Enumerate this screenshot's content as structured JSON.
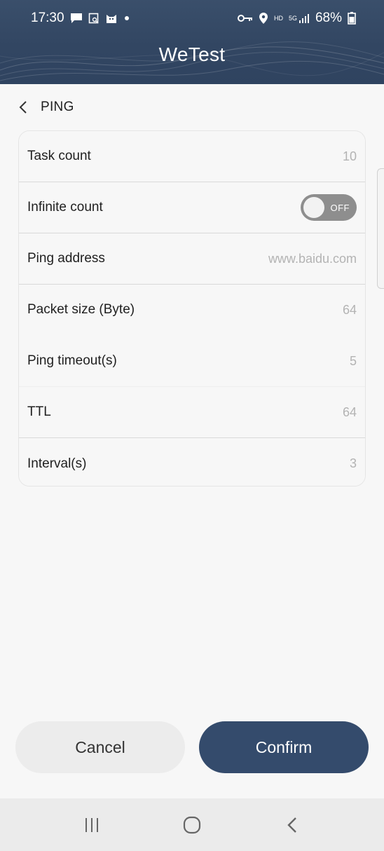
{
  "status_bar": {
    "time": "17:30",
    "left_icons": [
      "chat-icon",
      "screenshot-icon",
      "cat-icon",
      "dot-icon"
    ],
    "right_icons": [
      "key-icon",
      "location-icon",
      "hd-icon",
      "5g-signal-icon"
    ],
    "hd_label": "HD",
    "network_label": "5G",
    "battery": "68%"
  },
  "app": {
    "title": "WeTest"
  },
  "page": {
    "title": "PING"
  },
  "settings": [
    {
      "label": "Task count",
      "value": "10"
    },
    {
      "label": "Infinite count",
      "toggle_text": "OFF",
      "toggle_on": false
    },
    {
      "label": "Ping address",
      "value": "www.baidu.com"
    },
    {
      "label": "Packet size (Byte)",
      "value": "64"
    },
    {
      "label": "Ping timeout(s)",
      "value": "5"
    },
    {
      "label": "TTL",
      "value": "64"
    },
    {
      "label": "Interval(s)",
      "value": "3"
    }
  ],
  "actions": {
    "cancel": "Cancel",
    "confirm": "Confirm"
  },
  "colors": {
    "header": "#324662",
    "confirm": "#344b6c",
    "toggle_off": "#8e8e8e"
  }
}
